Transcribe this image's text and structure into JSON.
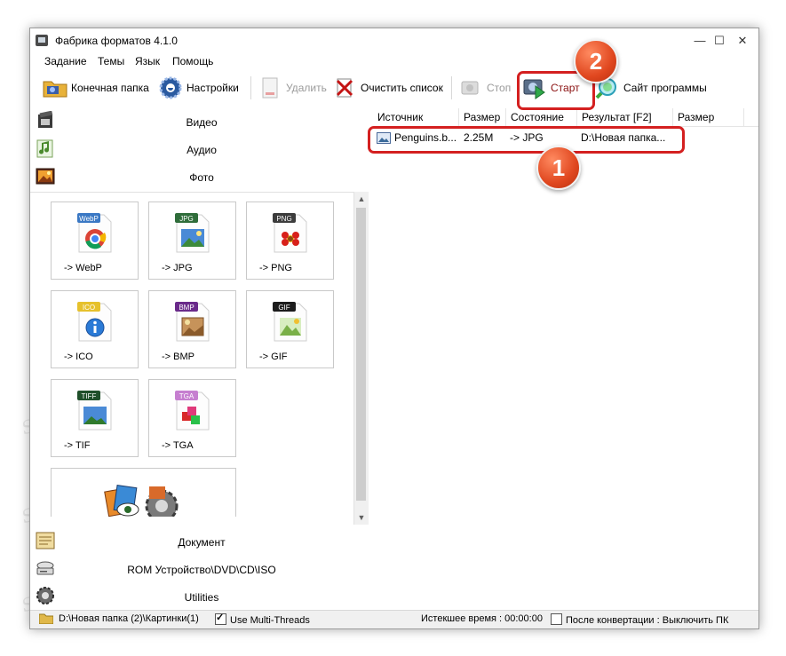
{
  "window": {
    "title": "Фабрика форматов 4.1.0",
    "controls": {
      "minimize": "—",
      "maximize": "☐",
      "close": "✕"
    }
  },
  "menu": [
    "Задание",
    "Темы",
    "Язык",
    "Помощь"
  ],
  "toolbar": {
    "dest_folder": "Конечная папка",
    "settings": "Настройки",
    "delete": "Удалить",
    "clear_list": "Очистить список",
    "stop": "Стоп",
    "start": "Старт",
    "website": "Сайт программы"
  },
  "categories": {
    "video": "Видео",
    "audio": "Аудио",
    "photo": "Фото",
    "document": "Документ",
    "rom": "ROM Устройство\\DVD\\CD\\ISO",
    "utilities": "Utilities"
  },
  "formats": [
    {
      "badge": "WebP",
      "label": "-> WebP",
      "color": "#3a78c4"
    },
    {
      "badge": "JPG",
      "label": "-> JPG",
      "color": "#2f6d3a"
    },
    {
      "badge": "PNG",
      "label": "-> PNG",
      "color": "#3c3c3c"
    },
    {
      "badge": "ICO",
      "label": "-> ICO",
      "color": "#e6c12c"
    },
    {
      "badge": "BMP",
      "label": "-> BMP",
      "color": "#6a2a8a"
    },
    {
      "badge": "GIF",
      "label": "-> GIF",
      "color": "#1c1c1c"
    },
    {
      "badge": "TIFF",
      "label": "-> TIF",
      "color": "#1f4f2a"
    },
    {
      "badge": "TGA",
      "label": "-> TGA",
      "color": "#c67fd0"
    }
  ],
  "table": {
    "headers": [
      "Источник",
      "Размер",
      "Состояние",
      "Результат [F2]",
      "Размер"
    ],
    "rows": [
      {
        "source": "Penguins.b...",
        "size": "2.25M",
        "state": "-> JPG",
        "result": "D:\\Новая папка...",
        "out_size": ""
      }
    ]
  },
  "status": {
    "path": "D:\\Новая папка (2)\\Картинки(1)",
    "multithreads": "Use Multi-Threads",
    "elapsed": "Истекшее время : 00:00:00",
    "after": "После конвертации : Выключить ПК"
  },
  "callouts": [
    "1",
    "2"
  ],
  "watermark": "Soringpcrepair.com",
  "colors": {
    "callout_red": "#d42020",
    "badge_orange": "#e0471f"
  }
}
